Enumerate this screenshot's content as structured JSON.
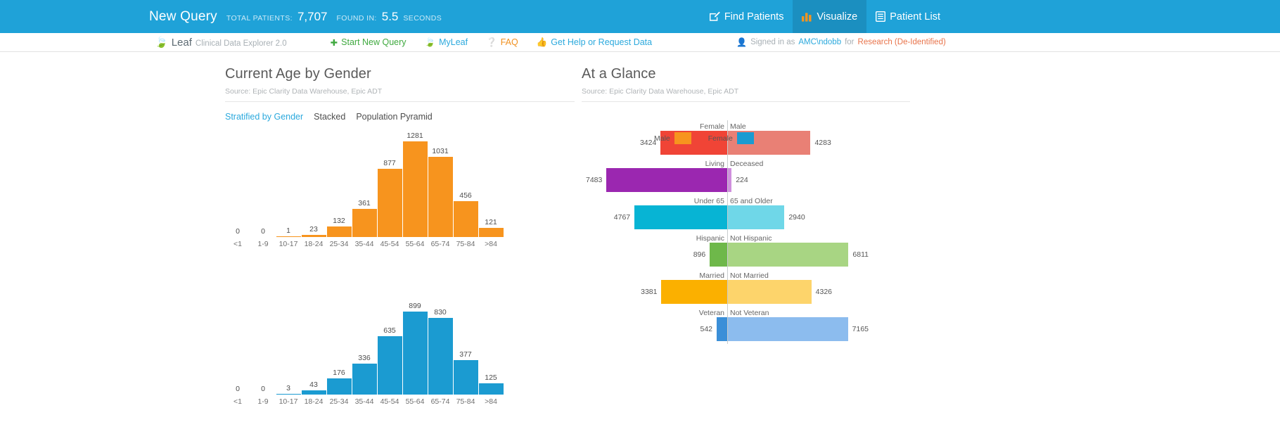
{
  "topbar": {
    "query_title": "New Query",
    "total_patients_label": "TOTAL PATIENTS:",
    "total_patients_value": "7,707",
    "found_in_label": "FOUND IN:",
    "found_in_value": "5.5",
    "seconds_label": "SECONDS",
    "nav": [
      {
        "label": "Find Patients",
        "icon": "edit-square-icon",
        "active": false
      },
      {
        "label": "Visualize",
        "icon": "bar-chart-icon",
        "active": true
      },
      {
        "label": "Patient List",
        "icon": "list-icon",
        "active": false
      }
    ],
    "accent_color": "#1fa2d8",
    "active_color": "#1b8fc0"
  },
  "subbar": {
    "brand_name": "Leaf",
    "brand_tagline": "Clinical Data Explorer 2.0",
    "links": [
      {
        "label": "Start New Query",
        "icon": "plus-icon",
        "color": "#3fa93f"
      },
      {
        "label": "MyLeaf",
        "icon": "leaf-icon",
        "color": "#2ba9dd"
      },
      {
        "label": "FAQ",
        "icon": "question-circle-icon",
        "color": "#f0901f"
      },
      {
        "label": "Get Help or Request Data",
        "icon": "thumbs-up-icon",
        "color": "#2ba9dd"
      }
    ],
    "signed_in_prefix": "Signed in as",
    "account": "AMC\\ndobb",
    "for_label": "for",
    "context": "Research (De-Identified)"
  },
  "left_panel": {
    "title": "Current Age by Gender",
    "source": "Source: Epic Clarity Data Warehouse, Epic ADT",
    "modes": [
      {
        "label": "Stratified by Gender",
        "active": true
      },
      {
        "label": "Stacked",
        "active": false
      },
      {
        "label": "Population Pyramid",
        "active": false
      }
    ],
    "legend": [
      {
        "label": "Male",
        "color": "#f7941e"
      },
      {
        "label": "Female",
        "color": "#1b9bd1"
      }
    ]
  },
  "right_panel": {
    "title": "At a Glance",
    "source": "Source: Epic Clarity Data Warehouse, Epic ADT"
  },
  "chart_data": [
    {
      "type": "bar",
      "title": "Current Age by Gender",
      "series_name": "Male",
      "color": "#f7941e",
      "categories": [
        "<1",
        "1-9",
        "10-17",
        "18-24",
        "25-34",
        "35-44",
        "45-54",
        "55-64",
        "65-74",
        "75-84",
        ">84"
      ],
      "values": [
        0,
        0,
        1,
        23,
        132,
        361,
        877,
        1281,
        1031,
        456,
        121
      ],
      "xlabel": "",
      "ylabel": "",
      "ylim": [
        0,
        1281
      ],
      "grid": false,
      "legend_position": "top-right"
    },
    {
      "type": "bar",
      "title": "Current Age by Gender",
      "series_name": "Female",
      "color": "#1b9bd1",
      "categories": [
        "<1",
        "1-9",
        "10-17",
        "18-24",
        "25-34",
        "35-44",
        "45-54",
        "55-64",
        "65-74",
        "75-84",
        ">84"
      ],
      "values": [
        0,
        0,
        3,
        43,
        176,
        336,
        635,
        899,
        830,
        377,
        125
      ],
      "xlabel": "",
      "ylabel": "",
      "ylim": [
        0,
        899
      ],
      "grid": false,
      "legend_position": "top-right"
    },
    {
      "type": "bar",
      "title": "At a Glance",
      "orientation": "horizontal-diverging",
      "rows": [
        {
          "left_label": "Female",
          "left_value": 3424,
          "left_color": "#f04436",
          "right_label": "Male",
          "right_value": 4283,
          "right_color": "#e98075"
        },
        {
          "left_label": "Living",
          "left_value": 7483,
          "left_color": "#9b27b0",
          "right_label": "Deceased",
          "right_value": 224,
          "right_color": "#cf8fdd"
        },
        {
          "left_label": "Under 65",
          "left_value": 4767,
          "left_color": "#07b4d4",
          "right_label": "65 and Older",
          "right_value": 2940,
          "right_color": "#6fd7e8"
        },
        {
          "left_label": "Hispanic",
          "left_value": 896,
          "left_color": "#6eb84a",
          "right_label": "Not Hispanic",
          "right_value": 6811,
          "right_color": "#a8d583"
        },
        {
          "left_label": "Married",
          "left_value": 3381,
          "left_color": "#fbb000",
          "right_label": "Not Married",
          "right_value": 4326,
          "right_color": "#fdd46b"
        },
        {
          "left_label": "Veteran",
          "left_value": 542,
          "left_color": "#3b8fd8",
          "right_label": "Not Veteran",
          "right_value": 7165,
          "right_color": "#8cbcee"
        }
      ],
      "max_scale": 7483
    }
  ]
}
